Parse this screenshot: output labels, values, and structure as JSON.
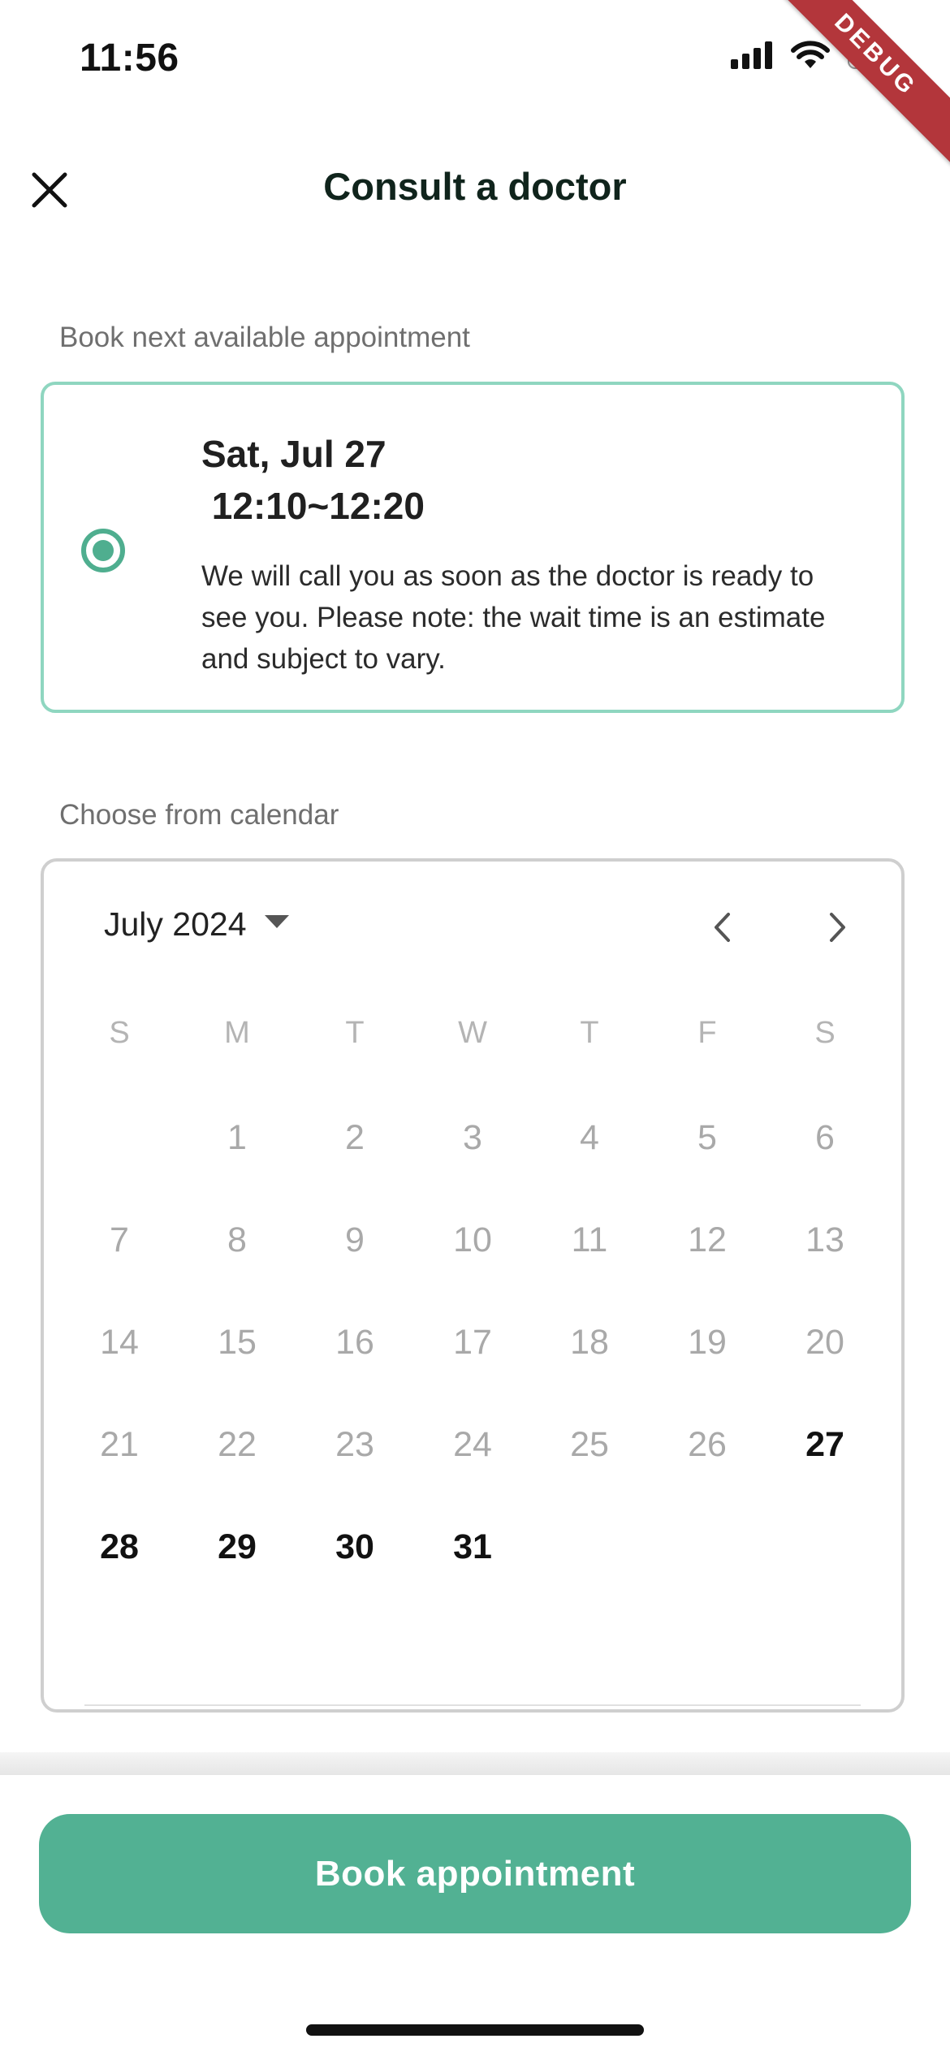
{
  "status_bar": {
    "time": "11:56",
    "debug_banner": "DEBUG",
    "icons": [
      "signal-icon",
      "wifi-icon",
      "battery-charging-icon"
    ]
  },
  "header": {
    "title": "Consult a doctor",
    "close_icon": "close-icon"
  },
  "next_available": {
    "section_label": "Book next available appointment",
    "selected": true,
    "date": "Sat, Jul 27",
    "time": " 12:10~12:20",
    "note": "We will call you as soon as the doctor is ready to see you. Please note: the wait time is an estimate and subject to vary."
  },
  "calendar": {
    "section_label": "Choose from calendar",
    "month": "July 2024",
    "weekdays": [
      "S",
      "M",
      "T",
      "W",
      "T",
      "F",
      "S"
    ],
    "first_weekday_index": 1,
    "days": [
      "1",
      "2",
      "3",
      "4",
      "5",
      "6",
      "7",
      "8",
      "9",
      "10",
      "11",
      "12",
      "13",
      "14",
      "15",
      "16",
      "17",
      "18",
      "19",
      "20",
      "21",
      "22",
      "23",
      "24",
      "25",
      "26",
      "27",
      "28",
      "29",
      "30",
      "31"
    ],
    "available_days": [
      "27",
      "28",
      "29",
      "30",
      "31"
    ]
  },
  "footer": {
    "book_button": "Book appointment"
  },
  "colors": {
    "accent": "#52b193",
    "card_border": "#8fd6c0",
    "debug_ribbon": "#b3363b"
  }
}
